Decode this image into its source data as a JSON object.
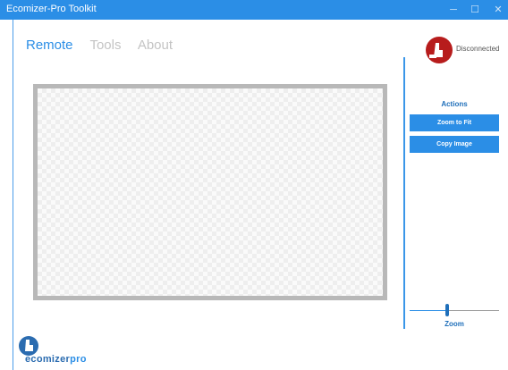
{
  "window": {
    "title": "Ecomizer-Pro Toolkit",
    "controls": [
      "─",
      "☐",
      "✕"
    ]
  },
  "nav": {
    "tabs": [
      {
        "label": "Remote",
        "active": true
      },
      {
        "label": "Tools",
        "active": false
      },
      {
        "label": "About",
        "active": false
      }
    ]
  },
  "status": {
    "text": "Disconnected",
    "icon": "disconnected-plug-icon",
    "color": "#b71c1c"
  },
  "canvas": {
    "placeholder": "transparent-checkerboard"
  },
  "actions": {
    "heading": "Actions",
    "zoom_to_fit": "Zoom to Fit",
    "copy_image": "Copy Image"
  },
  "zoom": {
    "label": "Zoom",
    "level": 0.42
  },
  "logo": {
    "text_main": "ecomizer",
    "text_pro": "pro",
    "icon": "ecomizer-logo-icon"
  },
  "colors": {
    "accent": "#2b8ee6",
    "accent_dark": "#1f6fba",
    "status_red": "#b71c1c",
    "canvas_border": "#b8b8b8"
  }
}
